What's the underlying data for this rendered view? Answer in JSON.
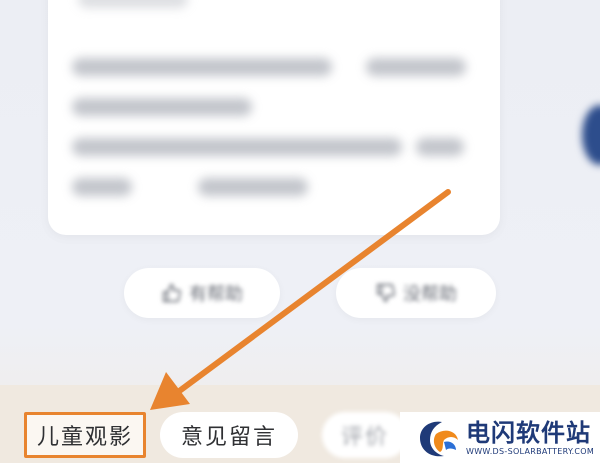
{
  "card": {
    "reply_text_lines": 5
  },
  "actions": {
    "like_label": "有帮助",
    "unlike_label": "没帮助"
  },
  "bottom_tags": {
    "kids_mode": "儿童观影",
    "feedback": "意见留言",
    "more": "评价"
  },
  "annotation": {
    "arrow_color": "#e8842f",
    "highlight_color": "#e8842f"
  },
  "watermark": {
    "title": "电闪软件站",
    "subtitle": "WWW.DS-SOLARBATTERY.COM",
    "color": "#1f3a78",
    "accent": "#f08a1c"
  }
}
